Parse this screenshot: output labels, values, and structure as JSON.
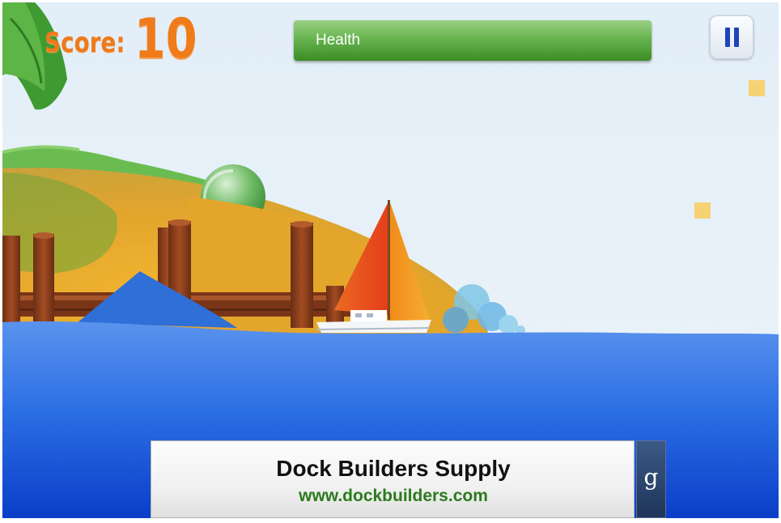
{
  "hud": {
    "score_label": "Score:",
    "score_value": "10",
    "health_label": "Health",
    "health_level": 1.0,
    "pause_icon": "pause-icon"
  },
  "ad": {
    "title": "Dock Builders Supply",
    "url": "www.dockbuilders.com",
    "badge": "g"
  },
  "colors": {
    "score": "#f07b1a",
    "health": "#5fb046",
    "pause_icon": "#1e44b8",
    "water": "#2a6fe6",
    "sky": "#e4eff8",
    "island": "#e9a92c",
    "sail_orange": "#f39a1e",
    "sail_red": "#e8471c",
    "pickup": "#f7d274",
    "ad_url": "#2b7a1d"
  }
}
